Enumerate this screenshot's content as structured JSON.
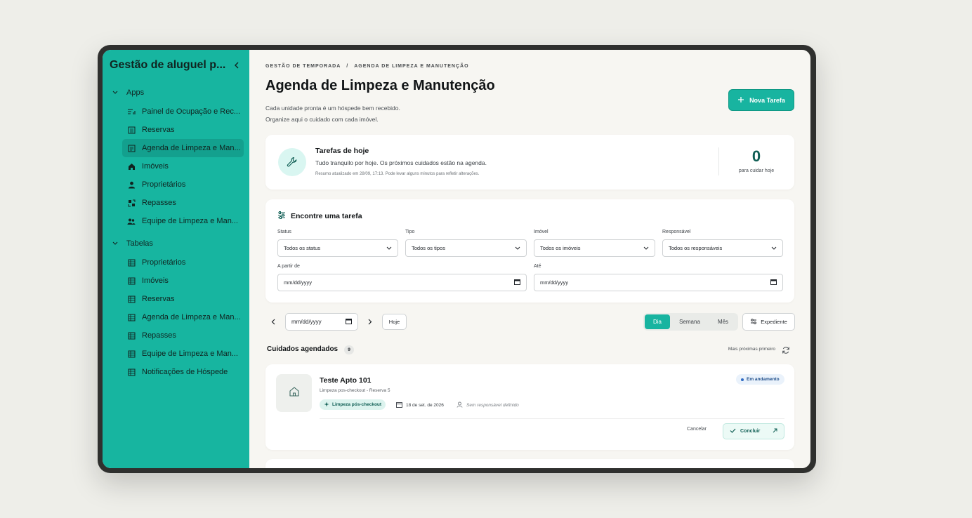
{
  "sidebar": {
    "title": "Gestão de aluguel p...",
    "groups": [
      {
        "label": "Apps",
        "items": [
          {
            "label": "Painel de Ocupação e Rec...",
            "icon": "dashboard-icon"
          },
          {
            "label": "Reservas",
            "icon": "list-icon"
          },
          {
            "label": "Agenda de Limpeza e Man...",
            "icon": "calendar-list-icon",
            "active": true
          },
          {
            "label": "Imóveis",
            "icon": "home-icon"
          },
          {
            "label": "Proprietários",
            "icon": "person-icon"
          },
          {
            "label": "Repasses",
            "icon": "transfer-icon"
          },
          {
            "label": "Equipe de Limpeza e Man...",
            "icon": "team-icon"
          }
        ]
      },
      {
        "label": "Tabelas",
        "items": [
          {
            "label": "Proprietários",
            "icon": "table-icon"
          },
          {
            "label": "Imóveis",
            "icon": "table-icon"
          },
          {
            "label": "Reservas",
            "icon": "table-icon"
          },
          {
            "label": "Agenda de Limpeza e Man...",
            "icon": "table-icon"
          },
          {
            "label": "Repasses",
            "icon": "table-icon"
          },
          {
            "label": "Equipe de Limpeza e Man...",
            "icon": "table-icon"
          },
          {
            "label": "Notificações de Hóspede",
            "icon": "table-icon"
          }
        ]
      }
    ]
  },
  "header": {
    "breadcrumb": [
      "GESTÃO DE TEMPORADA",
      "/",
      "AGENDA DE LIMPEZA E MANUTENÇÃO"
    ],
    "title": "Agenda de Limpeza e Manutenção",
    "subtitle_line1": "Cada unidade pronta é um hóspede bem recebido.",
    "subtitle_line2": "Organize aqui o cuidado com cada imóvel.",
    "new_task_label": "Nova Tarefa"
  },
  "today": {
    "title": "Tarefas de hoje",
    "text": "Tudo tranquilo por hoje. Os próximos cuidados estão na agenda.",
    "note": "Resumo atualizado em 28/09, 17:13. Pode levar alguns minutos para refletir alterações.",
    "count": "0",
    "count_label": "para cuidar hoje"
  },
  "filters": {
    "title": "Encontre uma tarefa",
    "status_label": "Status",
    "status_value": "Todos os status",
    "type_label": "Tipo",
    "type_value": "Todos os tipos",
    "property_label": "Imóvel",
    "property_value": "Todos os imóveis",
    "owner_label": "Responsável",
    "owner_value": "Todos os responsáveis",
    "from_label": "A partir de",
    "from_value": "mm/dd/yyyy",
    "to_label": "Até",
    "to_value": "mm/dd/yyyy"
  },
  "nav": {
    "date_value": "mm/dd/yyyy",
    "today_label": "Hoje",
    "views": [
      "Dia",
      "Semana",
      "Mês"
    ],
    "active_view": "Dia",
    "expediente_label": "Expediente"
  },
  "scheduled": {
    "title": "Cuidados agendados",
    "count": "9",
    "sort_label": "Mais próximas primeiro"
  },
  "task": {
    "title": "Teste Apto 101",
    "subtitle": "Limpeza pos-checkout - Reserva 5",
    "tag": "Limpeza pós-checkout",
    "date": "18 de set. de 2026",
    "assignee": "Sem responsável definido",
    "status": "Em andamento",
    "cancel_label": "Cancelar",
    "conclude_label": "Concluir"
  },
  "colors": {
    "accent": "#18b4a0",
    "sidebar_bg": "#17b5a0",
    "sidebar_active": "#13a08e",
    "count_color": "#0f5e54"
  }
}
